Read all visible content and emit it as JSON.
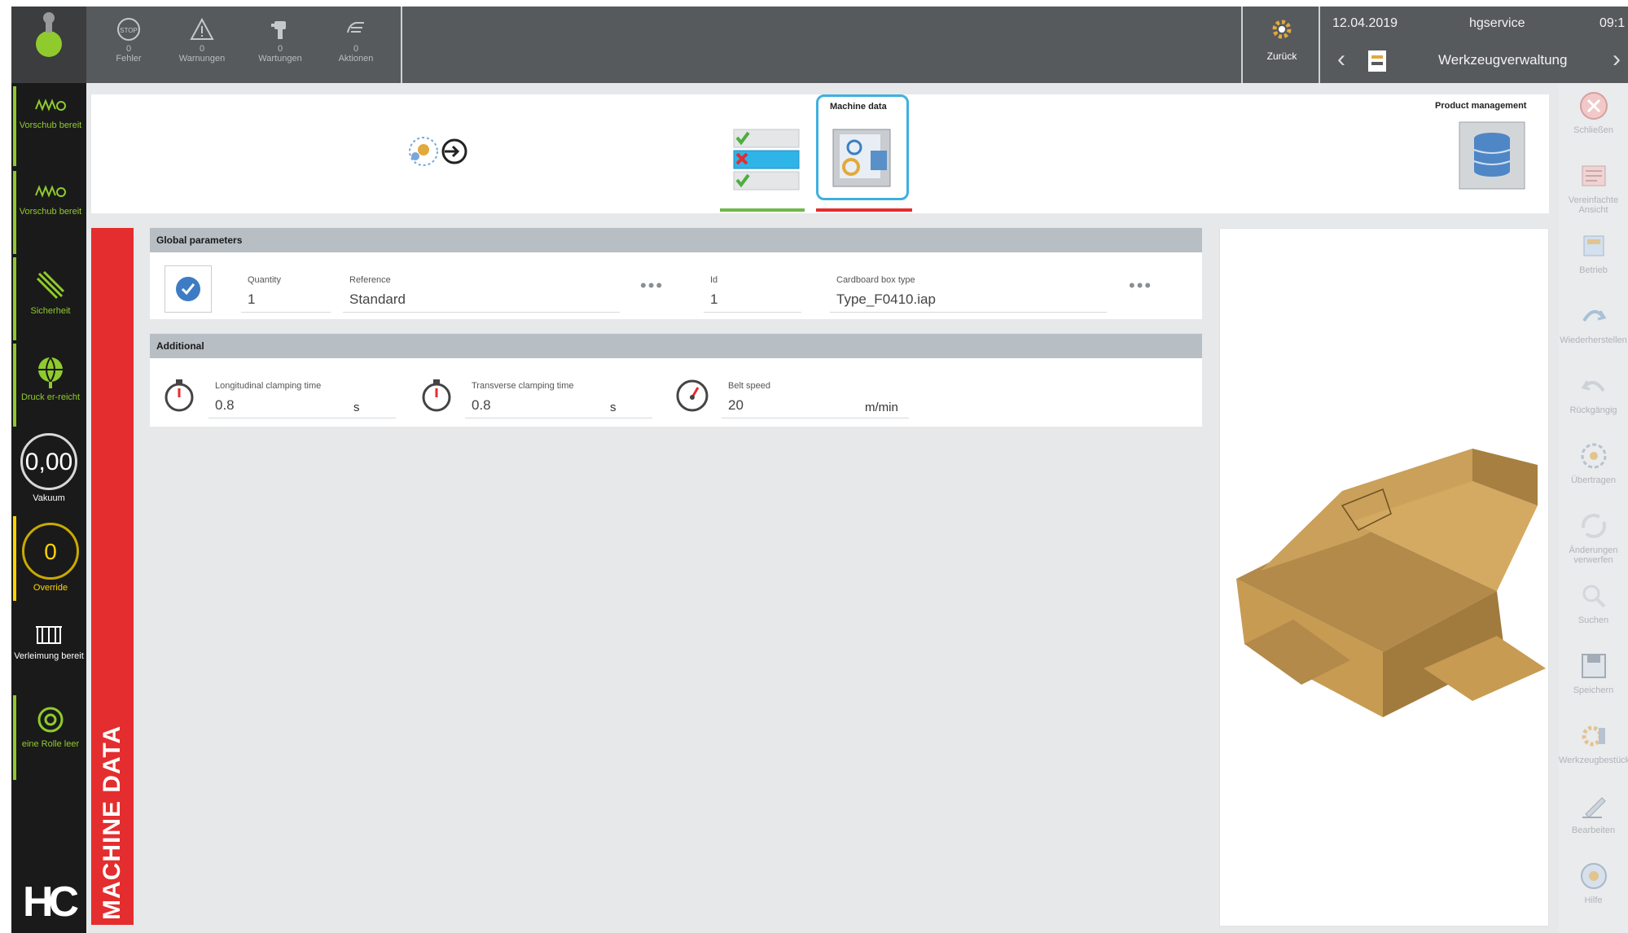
{
  "topbar": {
    "status": [
      {
        "icon": "stop-icon",
        "count": "0",
        "label": "Fehler"
      },
      {
        "icon": "warning-triangle-icon",
        "count": "0",
        "label": "Warnungen"
      },
      {
        "icon": "maintenance-icon",
        "count": "0",
        "label": "Wartungen"
      },
      {
        "icon": "action-hand-icon",
        "count": "0",
        "label": "Aktionen"
      }
    ],
    "back_label": "Zurück",
    "date": "12.04.2019",
    "user": "hgservice",
    "time": "09:1",
    "section_title": "Werkzeugverwaltung"
  },
  "sidebar": {
    "items": [
      {
        "icon": "feed-spring-icon",
        "label": "Vorschub bereit",
        "state": "green"
      },
      {
        "icon": "feed-spring-icon",
        "label": "Vorschub bereit",
        "state": "green"
      },
      {
        "icon": "safety-icon",
        "label": "Sicherheit",
        "state": "green"
      },
      {
        "icon": "pressure-globe-icon",
        "label": "Druck er-reicht",
        "state": "green"
      }
    ],
    "vacuum": {
      "value": "0,00",
      "label": "Vakuum"
    },
    "override": {
      "value": "0",
      "label": "Override"
    },
    "gluing": {
      "icon": "gluing-icon",
      "label": "Verleimung bereit"
    },
    "roll": {
      "icon": "roll-icon",
      "label": "eine Rolle leer"
    },
    "logo": "HC"
  },
  "tabs": {
    "machine_data_label": "Machine data",
    "product_management_label": "Product management"
  },
  "page_title": "MACHINE DATA",
  "global_parameters": {
    "title": "Global parameters",
    "quantity_label": "Quantity",
    "quantity_value": "1",
    "reference_label": "Reference",
    "reference_value": "Standard",
    "id_label": "Id",
    "id_value": "1",
    "box_type_label": "Cardboard box type",
    "box_type_value": "Type_F0410.iap",
    "more_dots": "•••"
  },
  "additional": {
    "title": "Additional",
    "long_label": "Longitudinal clamping time",
    "long_value": "0.8",
    "long_unit": "s",
    "trans_label": "Transverse clamping time",
    "trans_value": "0.8",
    "trans_unit": "s",
    "belt_label": "Belt speed",
    "belt_value": "20",
    "belt_unit": "m/min"
  },
  "rightbar": {
    "items": [
      {
        "icon": "close-circle-icon",
        "label": "Schließen"
      },
      {
        "icon": "simplified-view-icon",
        "label": "Vereinfachte Ansicht"
      },
      {
        "icon": "operation-icon",
        "label": "Betrieb"
      },
      {
        "icon": "restore-icon",
        "label": "Wiederherstellen"
      },
      {
        "icon": "undo-icon",
        "label": "Rückgängig"
      },
      {
        "icon": "transfer-icon",
        "label": "Übertragen"
      },
      {
        "icon": "refresh-icon",
        "label": "Änderungen verwerfen"
      },
      {
        "icon": "search-icon",
        "label": "Suchen"
      },
      {
        "icon": "save-icon",
        "label": "Speichern"
      },
      {
        "icon": "tool-config-icon",
        "label": "Werkzeugbestückung"
      },
      {
        "icon": "edit-icon",
        "label": "Bearbeiten"
      },
      {
        "icon": "help-icon",
        "label": "Hilfe"
      }
    ]
  }
}
